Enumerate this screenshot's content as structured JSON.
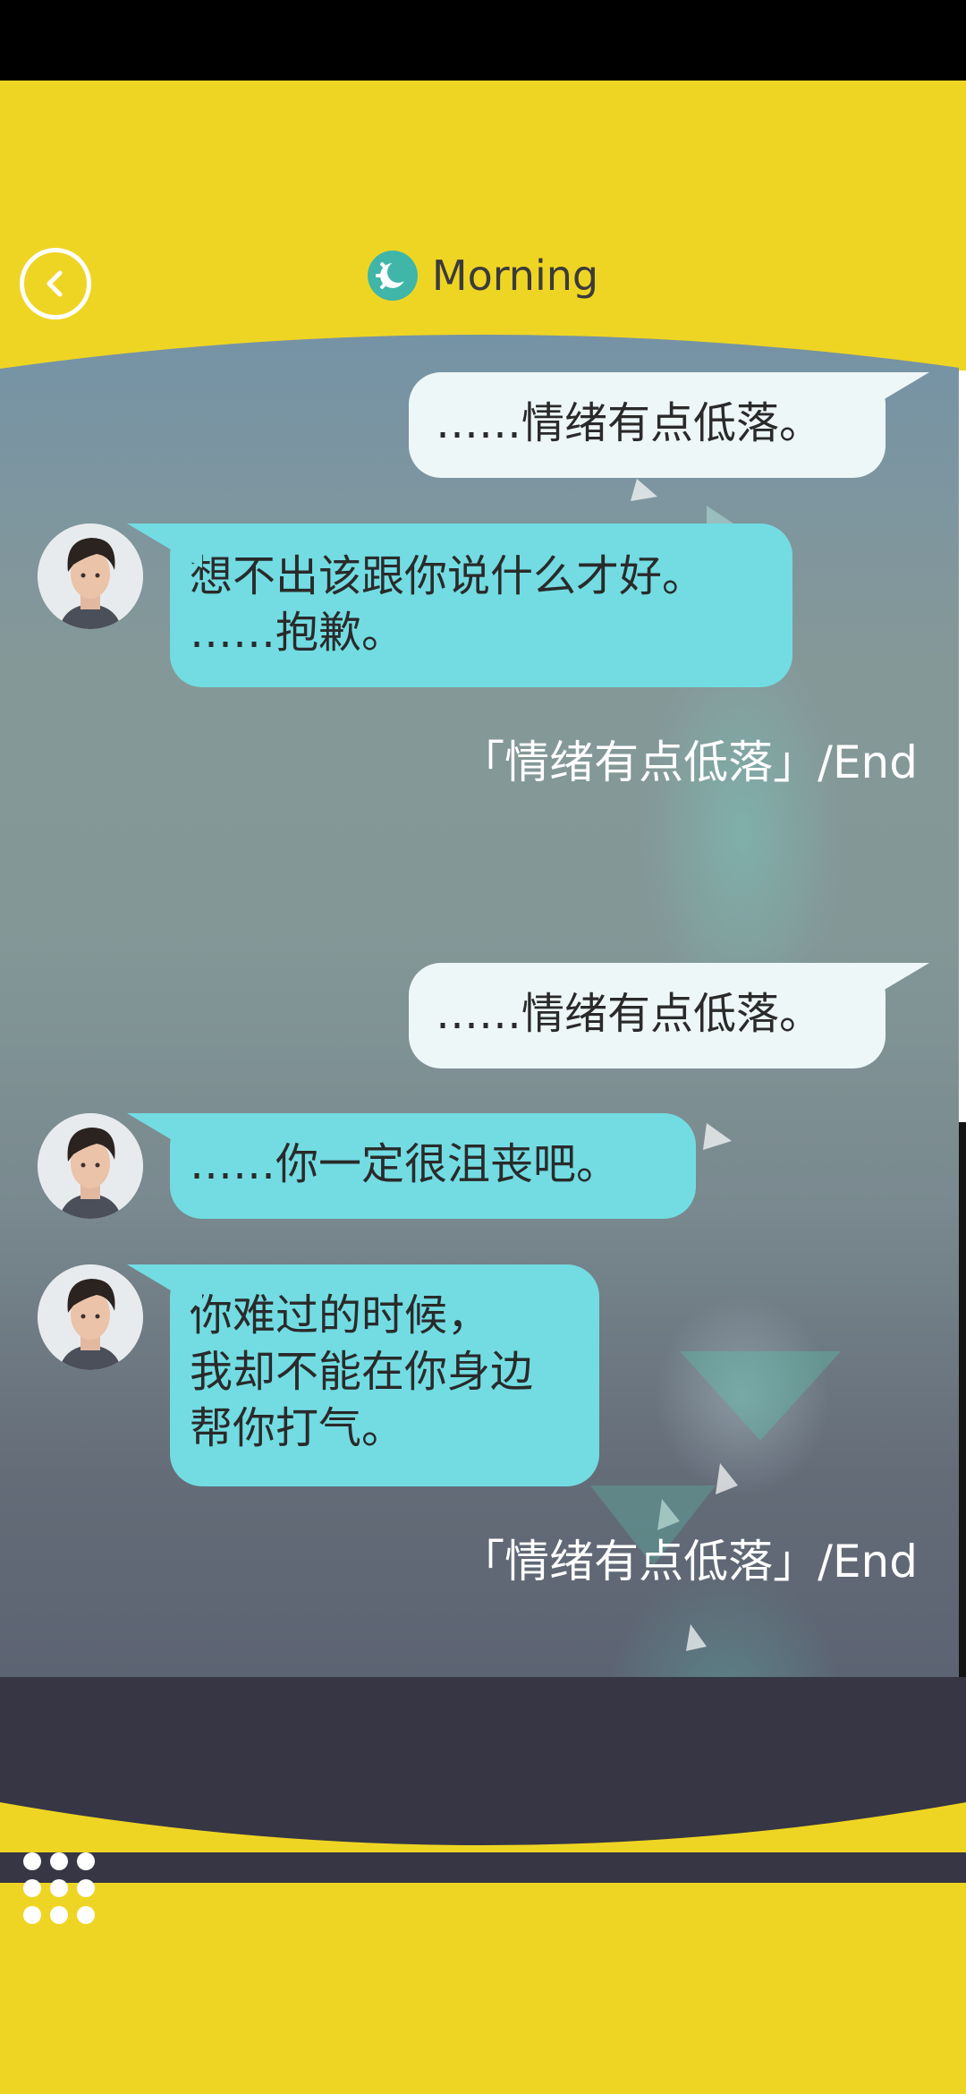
{
  "header": {
    "title": "Morning"
  },
  "chat": {
    "user_msg_1": "……情绪有点低落。",
    "npc_msg_1_line1": "想不出该跟你说什么才好。",
    "npc_msg_1_line2": "……抱歉。",
    "end_label_1": "「情绪有点低落」/End",
    "user_msg_2": "……情绪有点低落。",
    "npc_msg_2": "……你一定很沮丧吧。",
    "npc_msg_3_line1": "你难过的时候，",
    "npc_msg_3_line2": "我却不能在你身边",
    "npc_msg_3_line3": "帮你打气。",
    "end_label_2": "「情绪有点低落」/End"
  },
  "colors": {
    "accent_yellow": "#efd523",
    "npc_bubble": "#72dce2",
    "user_bubble": "#eef7f7",
    "footer_dark": "#363644",
    "title_icon": "#3fb6a8"
  }
}
